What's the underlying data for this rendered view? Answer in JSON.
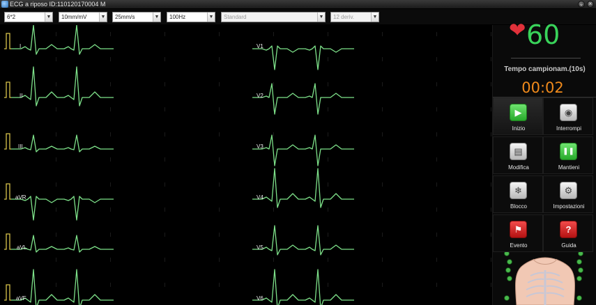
{
  "window": {
    "title": "ECG a riposo ID:110120170004  M",
    "minimize_glyph": "⌄",
    "close_glyph": "×"
  },
  "toolbar": {
    "selects": [
      {
        "value": "6*2",
        "disabled": false
      },
      {
        "value": "10mm/mV",
        "disabled": false
      },
      {
        "value": "25mm/s",
        "disabled": false
      },
      {
        "value": "100Hz",
        "disabled": false
      },
      {
        "value": "Standard",
        "disabled": true
      },
      {
        "value": "12 deriv.",
        "disabled": true
      }
    ],
    "arrow": "▼"
  },
  "ecg": {
    "trace_color": "#7ee28a",
    "calibration_color": "#d8c34a",
    "leads_left": [
      "I",
      "II",
      "III",
      "aVR",
      "aVL",
      "aVF"
    ],
    "leads_right": [
      "V1",
      "V2",
      "V3",
      "V4",
      "V5",
      "V6"
    ]
  },
  "monitor": {
    "heart_glyph": "❤",
    "heart_rate": "60",
    "sampling_label": "Tempo campionam.(10s)",
    "sampling_time": "00:02"
  },
  "buttons": [
    {
      "label": "Inizio",
      "icon": "play-icon",
      "color": "green",
      "glyph": "▶",
      "active": true
    },
    {
      "label": "Interrompi",
      "icon": "stop-icon",
      "color": "grey",
      "glyph": "◉",
      "active": false
    },
    {
      "label": "Modifica",
      "icon": "clipboard-icon",
      "color": "grey",
      "glyph": "▤",
      "active": false
    },
    {
      "label": "Mantieni",
      "icon": "pause-icon",
      "color": "green",
      "glyph": "❚❚",
      "active": false
    },
    {
      "label": "Blocco",
      "icon": "snowflake-icon",
      "color": "grey",
      "glyph": "❄",
      "active": false
    },
    {
      "label": "Impostazioni",
      "icon": "gear-icon",
      "color": "grey",
      "glyph": "⚙",
      "active": false
    },
    {
      "label": "Evento",
      "icon": "flag-icon",
      "color": "red",
      "glyph": "⚑",
      "active": false
    },
    {
      "label": "Guida",
      "icon": "help-icon",
      "color": "red",
      "glyph": "?",
      "active": false
    }
  ],
  "electrodes": [
    "R",
    "L",
    "C1",
    "C2",
    "C3",
    "C4",
    "C5",
    "C6",
    "RL",
    "LL"
  ]
}
